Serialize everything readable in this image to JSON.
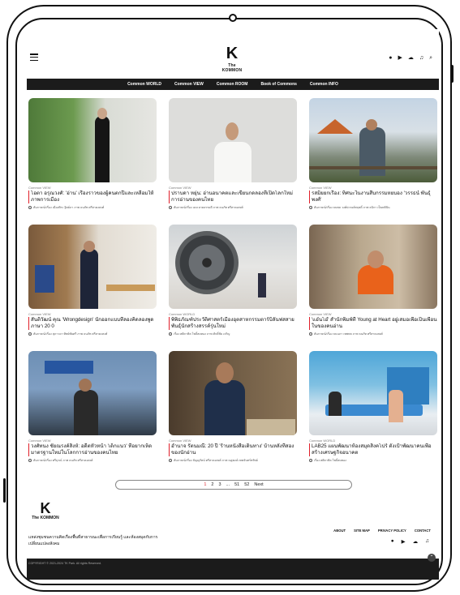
{
  "header": {
    "logo_mark": "K",
    "logo_text": "The KOMMON",
    "icons": [
      "facebook-icon",
      "youtube-icon",
      "podcast-icon",
      "spotify-icon",
      "search-icon"
    ]
  },
  "nav": [
    "Common WORLD",
    "Common VIEW",
    "Common ROOM",
    "Book of Commons",
    "Common INFO"
  ],
  "articles": [
    {
      "category": "Common VIEW",
      "title": "โอตา อรุณวงศ์: 'อ่าน' เรื่องราวของผู้คนตกปีและเหลื่อมให้ภาพการเมือง",
      "meta": "สัมภาษณ์/เรื่อง เมืองพิระ ฐิตย์ภา  ภาพ ธนภัท ศรีสาคงสงศ์"
    },
    {
      "category": "Common VIEW",
      "title": "ปราบดา หยุ่น: อ่านอนาคตและเขียนกดลองที่เปิดโลกใหม่การอ่านของคนไทย",
      "meta": "สัมภาษณ์/เรื่อง เมษ ยายธรรมดี  ภาพ ธนภัท ศรีสาคงสงศ์"
    },
    {
      "category": "Common VIEW",
      "title": "รสมิยยกเรื่อง: ทิศนะในงานสืบกรรมหยบอง 'วรรธน์ พันธุ์พงศ์'",
      "meta": "สัมภาษณ์/เรื่อง ธนพล วงศ์ปะหงส์สฤษดิ์  ภาพ ธนิกา เป็นพลินิน"
    },
    {
      "category": "Common VIEW",
      "title": "สันติวัฒน์ คุณ 'Wrongdesign' นักออกแบบที่ลองคิดลองพูดภาษา 20 0",
      "meta": "สัมภาษณ์/เรื่อง สุภาวดา ทิพย์ชัยศรี  ภาพ ธนภัท ศรีสาคงสงศ์"
    },
    {
      "category": "Common WORLD",
      "title": "พิพิธภัณฑ์ประวัติศาสตร์เมืองอุตสาหกรรมตาร์บิลันฟสสายพันธุ์นักสร้างสรรค์รุ่นใหม่",
      "meta": "เรื่อง ศศิภาพิล โพธิ์สมทอง  ภาพ ศักดิ์ชัย เจริญ"
    },
    {
      "category": "Common VIEW",
      "title": "'แอ๋นโอ๋' สำนักพิมพ์ที่ Young at Heart อยู่เสมอเพื่อเป็นเพื่อนในของคนอ่าน",
      "meta": "สัมภาษณ์/เรื่อง ธนนภา เทพพล  ภาพ ธนภัท ศรีสาคงสงศ์"
    },
    {
      "category": "Common VIEW",
      "title": "วงศ์ทนง ชัยณรงค์สิงห์: อดีตหัวหน้า 'เด็กแนว' ที่อยากเห็ดมาตรฐานใหม่ในโลกการอ่านของคนไทย",
      "meta": "สัมภาษณ์/เรื่อง ศรีบุรณ์  ภาพ ธนภัท ศรีสาคงสงศ์"
    },
    {
      "category": "Common VIEW",
      "title": "อำนาจ รัตนมณี: 20 ปี 'ร้านหนังสือเดินทาง' บ้านหลังที่สองของนักอ่าน",
      "meta": "สัมภาษณ์/เรื่อง ธัญญรัตน์ ศรีสาคงสงศ์  ภาพ ณฐพงษ์ เทพจันทร์ทรัพย์"
    },
    {
      "category": "Common WORLD",
      "title": "LAB25 แผนพัฒนาห้องสมุดสิงคโปร์ ตั้งเป้าพัฒนาคนเพื่อสร้างเศรษฐกิจอนาคต",
      "meta": "เรื่อง ศศิภาพิล โพธิ์สมทอง"
    }
  ],
  "pagination": {
    "current": "1",
    "pages": [
      "2",
      "3",
      "...",
      "51",
      "52"
    ],
    "next": "Next"
  },
  "footer": {
    "logo_mark": "K",
    "logo_text": "The KOMMON",
    "tagline": "แหล่งชุมชนความคิดเรื่องพื้นที่สาธารณะเพื่อการเรียนรู้ และห้องสมุดกับการเปลี่ยนแปลงสังคม",
    "links": [
      "ABOUT",
      "SITE MAP",
      "PRIVACY POLICY",
      "CONTACT"
    ],
    "social": [
      "facebook-icon",
      "youtube-icon",
      "podcast-icon",
      "spotify-icon"
    ],
    "copyright": "COPYRIGHT © 2021-2024 TK Park. All rights Reserved."
  }
}
